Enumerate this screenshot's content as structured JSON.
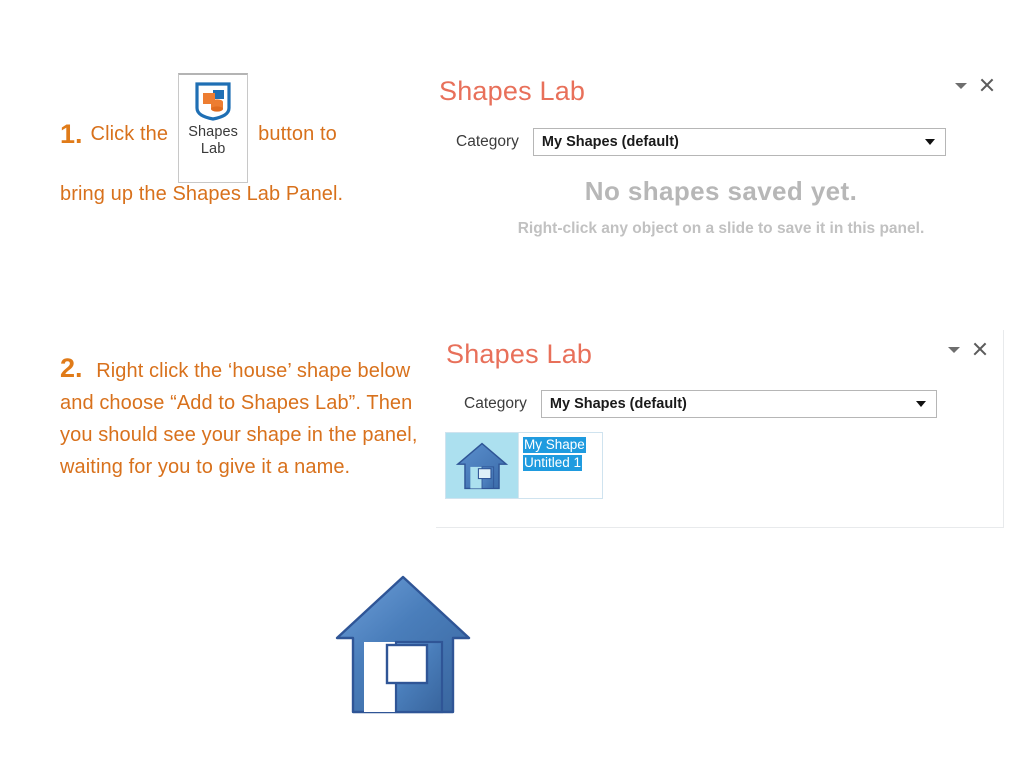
{
  "slide": {
    "background": "#ffffff",
    "accent_orange": "#D8711C",
    "panel_title_color": "#E8705A"
  },
  "steps": [
    {
      "number": "1.",
      "text_before": "Click the",
      "button": {
        "label_line1": "Shapes",
        "label_line2": "Lab",
        "icon": "shapes-lab-icon"
      },
      "text_after": "button to",
      "text_line2": "bring up the Shapes Lab Panel."
    },
    {
      "number": "2.",
      "text": "Right click the ‘house’ shape below and choose “Add to Shapes Lab”. Then you should see your shape in the panel, waiting for you to give it a name."
    }
  ],
  "panel_empty": {
    "title": "Shapes Lab",
    "category_label": "Category",
    "category_value": "My Shapes (default)",
    "empty_title": "No shapes saved yet.",
    "empty_subtitle": "Right-click any object on a slide to save it in this panel.",
    "collapse_icon": "chevron-down-icon",
    "close_icon": "close-icon"
  },
  "panel_filled": {
    "title": "Shapes Lab",
    "category_label": "Category",
    "category_value": "My Shapes (default)",
    "collapse_icon": "chevron-down-icon",
    "close_icon": "close-icon",
    "shape_item": {
      "thumbnail_icon": "house-shape-thumbnail",
      "name_line1": "My Shape",
      "name_line2": "Untitled 1",
      "thumbnail_background": "#ace0ef",
      "selection_color": "#1f9bdf"
    }
  },
  "house_shape": {
    "name": "house-shape",
    "fill": "#4A7EBB",
    "outline": "#2F5596"
  }
}
